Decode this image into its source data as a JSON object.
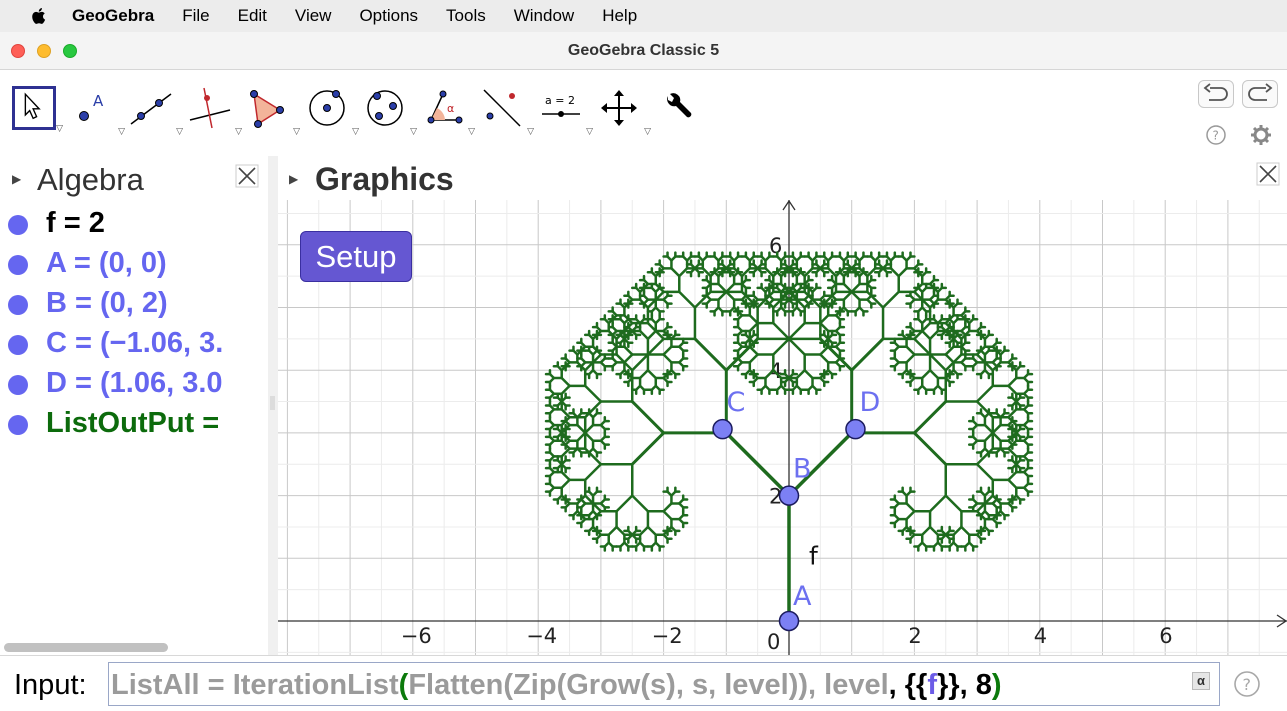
{
  "menubar": {
    "app_name": "GeoGebra",
    "items": [
      "File",
      "Edit",
      "View",
      "Options",
      "Tools",
      "Window",
      "Help"
    ]
  },
  "window": {
    "title": "GeoGebra Classic 5"
  },
  "toolbar": {
    "tools": [
      {
        "name": "move-tool",
        "selected": true
      },
      {
        "name": "point-tool"
      },
      {
        "name": "line-tool"
      },
      {
        "name": "perpendicular-line-tool"
      },
      {
        "name": "polygon-tool"
      },
      {
        "name": "circle-center-point-tool"
      },
      {
        "name": "circle-three-points-tool"
      },
      {
        "name": "angle-tool"
      },
      {
        "name": "reflect-tool"
      },
      {
        "name": "slider-tool",
        "label": "a = 2"
      },
      {
        "name": "move-graphics-view-tool"
      },
      {
        "name": "tool-customize"
      }
    ]
  },
  "algebra": {
    "title": "Algebra",
    "items": [
      {
        "text": "f = 2",
        "color": "#000000"
      },
      {
        "text": "A = (0, 0)",
        "color": "#6566f0"
      },
      {
        "text": "B = (0, 2)",
        "color": "#6566f0"
      },
      {
        "text": "C = (−1.06, 3.",
        "color": "#6566f0"
      },
      {
        "text": "D = (1.06, 3.0",
        "color": "#6566f0"
      },
      {
        "text": "ListOutPut =",
        "color": "#0c6b0c"
      }
    ]
  },
  "graphics": {
    "title": "Graphics",
    "setup_button": "Setup",
    "x_ticks": [
      "−6",
      "−4",
      "−2",
      "0",
      "2",
      "4",
      "6"
    ],
    "y_ticks": [
      "2",
      "4",
      "6"
    ],
    "points": [
      {
        "label": "A",
        "x": 0,
        "y": 0
      },
      {
        "label": "B",
        "x": 0,
        "y": 2
      },
      {
        "label": "C",
        "x": -1.06,
        "y": 3.06
      },
      {
        "label": "D",
        "x": 1.06,
        "y": 3.06
      }
    ],
    "segment_label": "f",
    "colors": {
      "tree": "#1e6b1e",
      "point": "#7c80f4",
      "point_label": "#6c70f0",
      "grid_major": "#c8c8c8",
      "grid_minor": "#ececec"
    }
  },
  "input": {
    "label": "Input:",
    "tokens": [
      {
        "t": "ListAll",
        "c": "grey"
      },
      {
        "t": " = ",
        "c": "grey"
      },
      {
        "t": "IterationList",
        "c": "grey"
      },
      {
        "t": "(",
        "c": "green"
      },
      {
        "t": "Flatten",
        "c": "grey"
      },
      {
        "t": "(",
        "c": "grey"
      },
      {
        "t": "Zip",
        "c": "grey"
      },
      {
        "t": "(",
        "c": "grey"
      },
      {
        "t": "Grow",
        "c": "grey"
      },
      {
        "t": "(",
        "c": "grey"
      },
      {
        "t": "s",
        "c": "grey"
      },
      {
        "t": "), ",
        "c": "grey"
      },
      {
        "t": "s",
        "c": "grey"
      },
      {
        "t": ", ",
        "c": "grey"
      },
      {
        "t": "level",
        "c": "grey"
      },
      {
        "t": ")), ",
        "c": "grey"
      },
      {
        "t": "level",
        "c": "grey"
      },
      {
        "t": ", {{",
        "c": "blk"
      },
      {
        "t": "f",
        "c": "blue"
      },
      {
        "t": "}}, 8",
        "c": "blk"
      },
      {
        "t": ")",
        "c": "green"
      }
    ],
    "alpha_symbol": "α"
  }
}
